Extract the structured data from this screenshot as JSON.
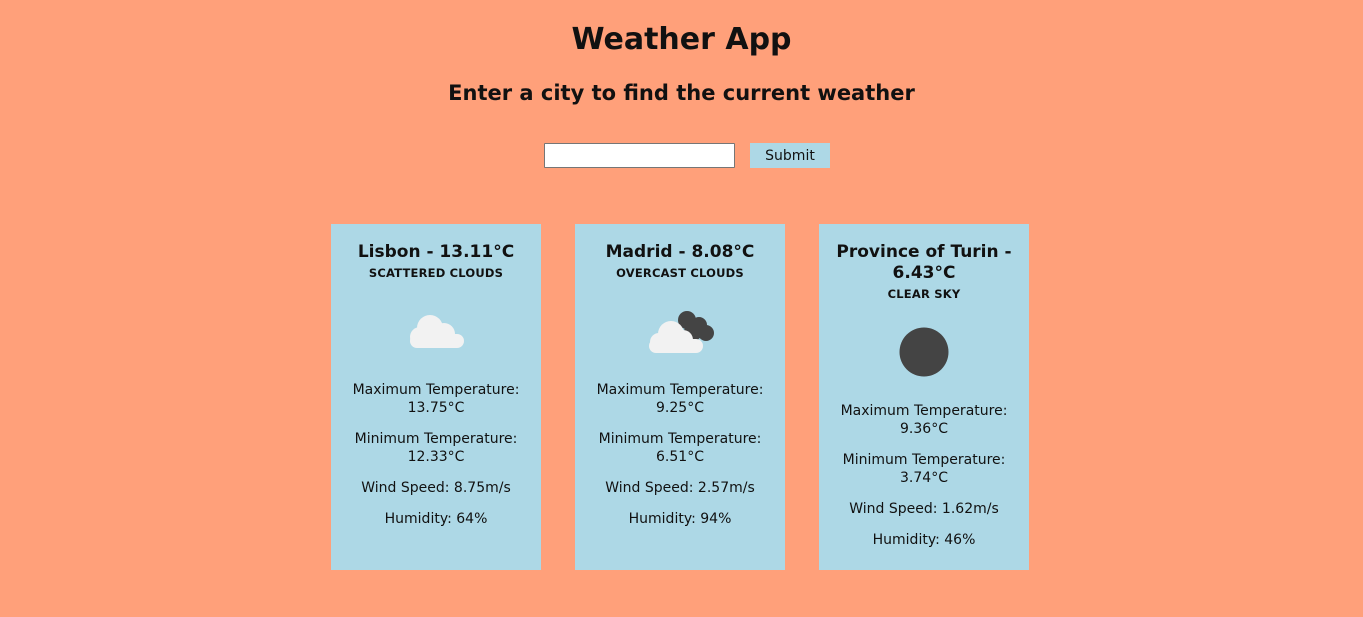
{
  "header": {
    "title": "Weather App",
    "subtitle": "Enter a city to find the current weather"
  },
  "search": {
    "value": "",
    "placeholder": "",
    "submit_label": "Submit"
  },
  "colors": {
    "background": "#ffa07a",
    "card": "#add8e6",
    "button": "#add8e6"
  },
  "cards": [
    {
      "title": "Lisbon - 13.11°C",
      "description": "scattered clouds",
      "icon": "cloud-icon",
      "max_label": "Maximum Temperature:",
      "max_value": "13.75°C",
      "min_label": "Minimum Temperature:",
      "min_value": "12.33°C",
      "wind": "Wind Speed: 8.75m/s",
      "humidity": "Humidity: 64%"
    },
    {
      "title": "Madrid - 8.08°C",
      "description": "overcast clouds",
      "icon": "overcast-clouds-icon",
      "max_label": "Maximum Temperature:",
      "max_value": "9.25°C",
      "min_label": "Minimum Temperature:",
      "min_value": "6.51°C",
      "wind": "Wind Speed: 2.57m/s",
      "humidity": "Humidity: 94%"
    },
    {
      "title": "Province of Turin - 6.43°C",
      "description": "clear sky",
      "icon": "clear-sky-icon",
      "max_label": "Maximum Temperature:",
      "max_value": "9.36°C",
      "min_label": "Minimum Temperature:",
      "min_value": "3.74°C",
      "wind": "Wind Speed: 1.62m/s",
      "humidity": "Humidity: 46%"
    }
  ]
}
